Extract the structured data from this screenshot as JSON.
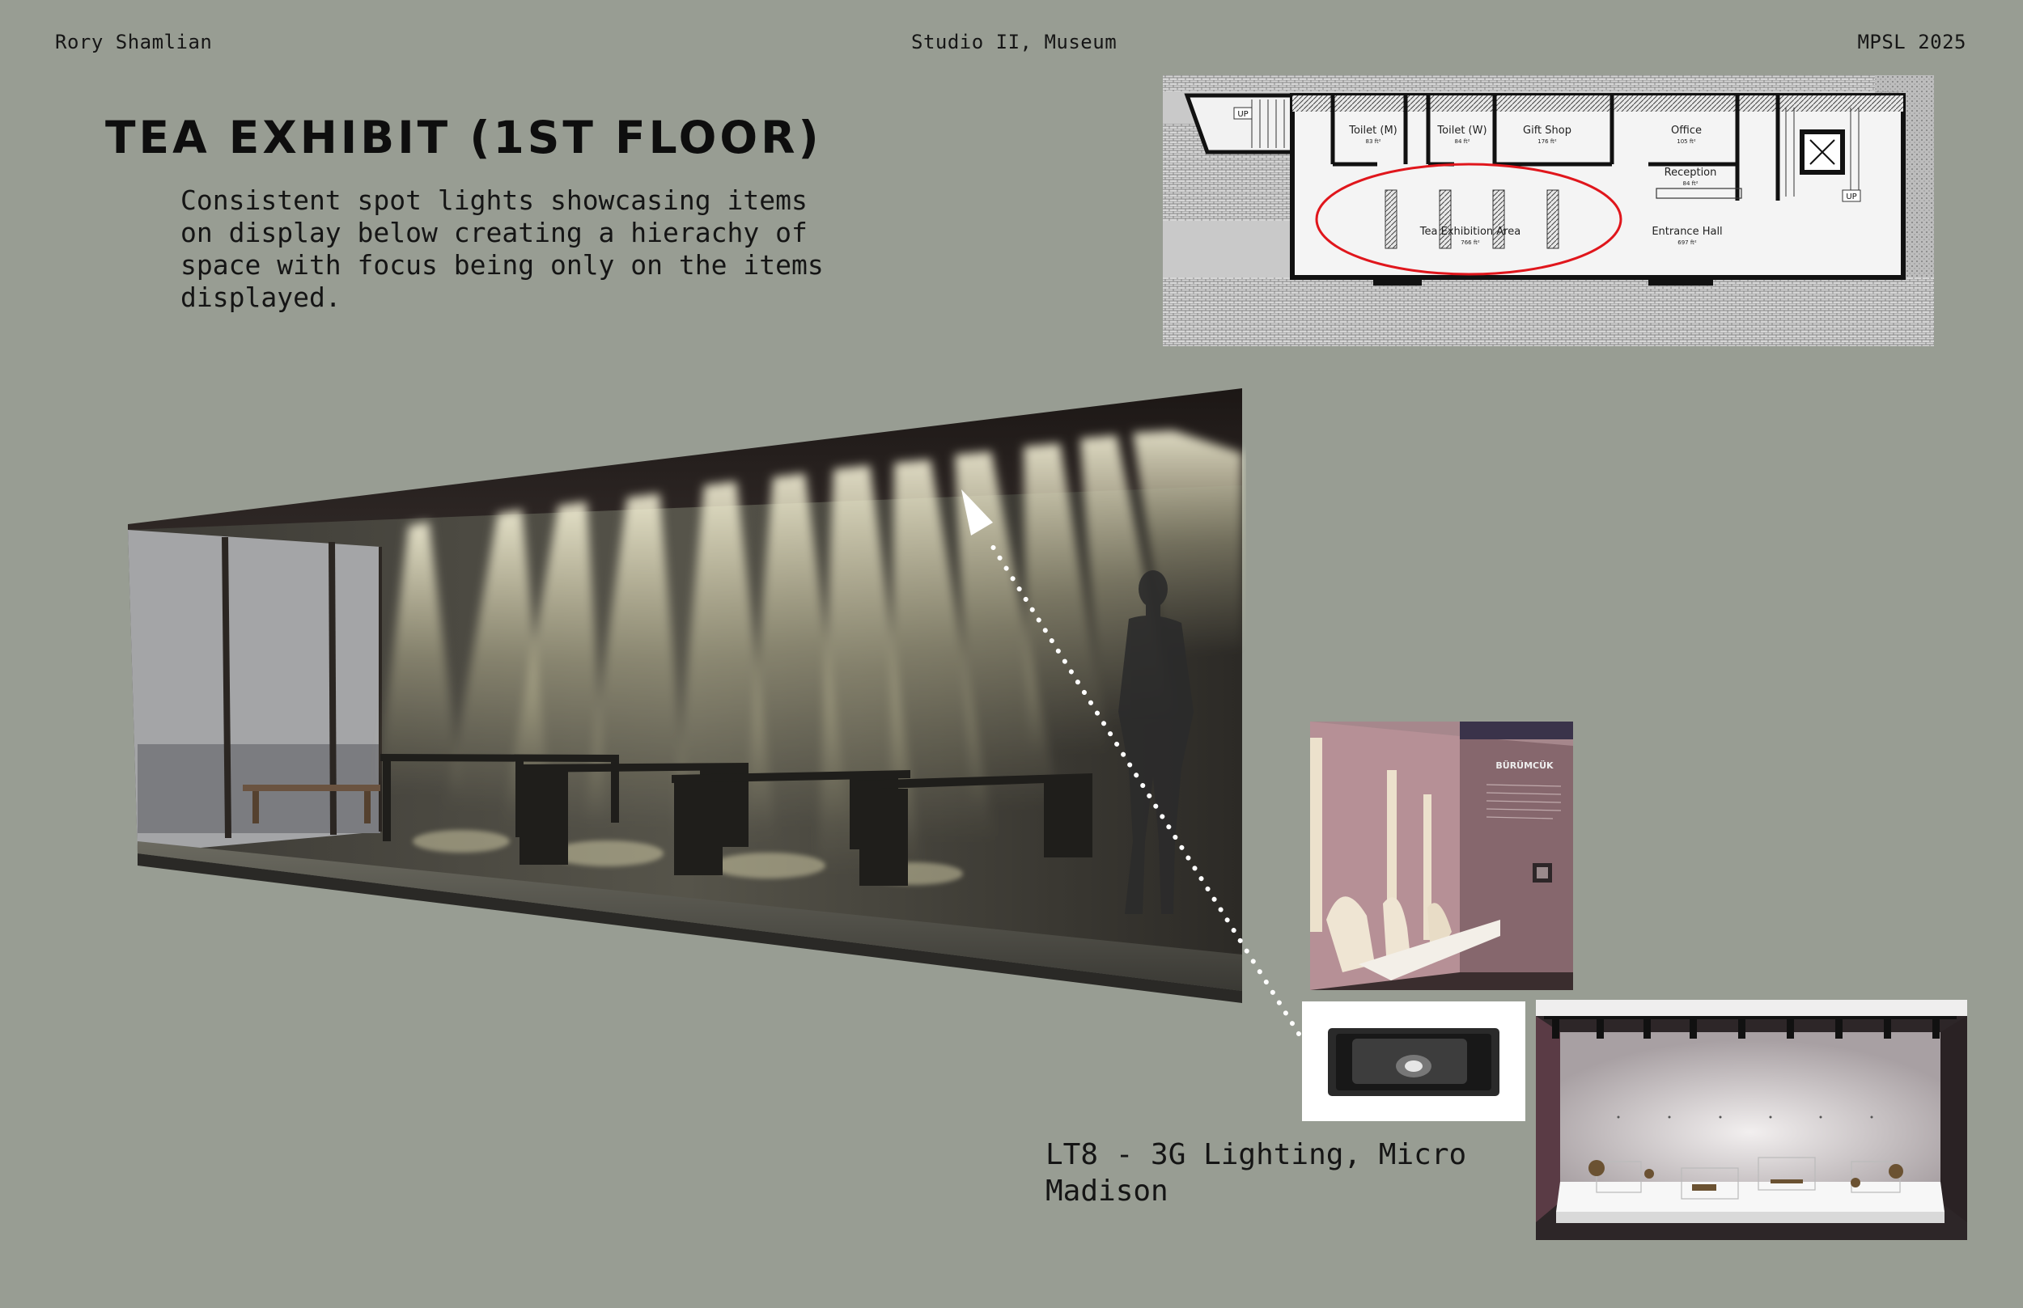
{
  "header": {
    "author": "Rory Shamlian",
    "course": "Studio II, Museum",
    "code": "MPSL 2025"
  },
  "title": "TEA EXHIBIT (1ST FLOOR)",
  "description": "Consistent spot lights showcasing items on display below creating a hierachy of space with focus being only on the items displayed.",
  "floor_plan": {
    "rooms": [
      {
        "name": "Toilet (M)",
        "area": "83 ft²"
      },
      {
        "name": "Toilet (W)",
        "area": "84 ft²"
      },
      {
        "name": "Gift Shop",
        "area": "176 ft²"
      },
      {
        "name": "Office",
        "area": "105 ft²"
      },
      {
        "name": "Reception",
        "area": "84 ft²"
      },
      {
        "name": "Tea Exhibition Area",
        "area": "766 ft²"
      },
      {
        "name": "Entrance Hall",
        "area": "697 ft²"
      }
    ],
    "stair_labels": [
      "UP",
      "UP"
    ],
    "highlight_color": "#e0161c"
  },
  "reference_photo": {
    "sign": "BÜRÜMCÜK"
  },
  "fixture_caption": "LT8 - 3G Lighting, Micro Madison"
}
